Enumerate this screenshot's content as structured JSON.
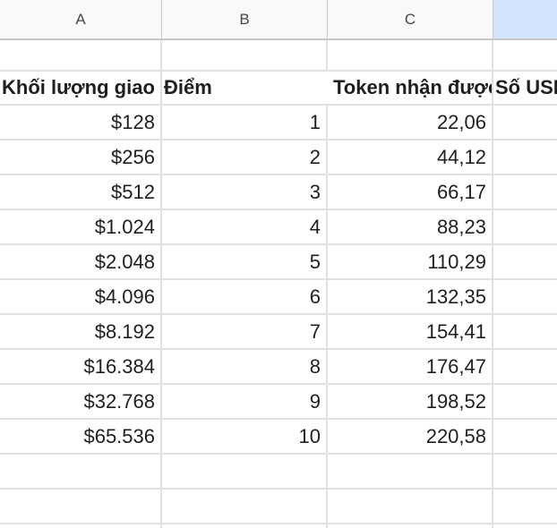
{
  "columns": [
    "A",
    "B",
    "C",
    ""
  ],
  "header_row": {
    "a": "Khối lượng giao dịch",
    "b": "Điểm",
    "c": "Token nhận được",
    "d": "Số USD"
  },
  "rows": [
    {
      "a": "$128",
      "b": "1",
      "c": "22,06"
    },
    {
      "a": "$256",
      "b": "2",
      "c": "44,12"
    },
    {
      "a": "$512",
      "b": "3",
      "c": "66,17"
    },
    {
      "a": "$1.024",
      "b": "4",
      "c": "88,23"
    },
    {
      "a": "$2.048",
      "b": "5",
      "c": "110,29"
    },
    {
      "a": "$4.096",
      "b": "6",
      "c": "132,35"
    },
    {
      "a": "$8.192",
      "b": "7",
      "c": "154,41"
    },
    {
      "a": "$16.384",
      "b": "8",
      "c": "176,47"
    },
    {
      "a": "$32.768",
      "b": "9",
      "c": "198,52"
    },
    {
      "a": "$65.536",
      "b": "10",
      "c": "220,58"
    }
  ],
  "colors": {
    "header_bg": "#f8f9fa",
    "selected_header_bg": "#d3e3fd",
    "gridline": "#e1e1e1"
  }
}
